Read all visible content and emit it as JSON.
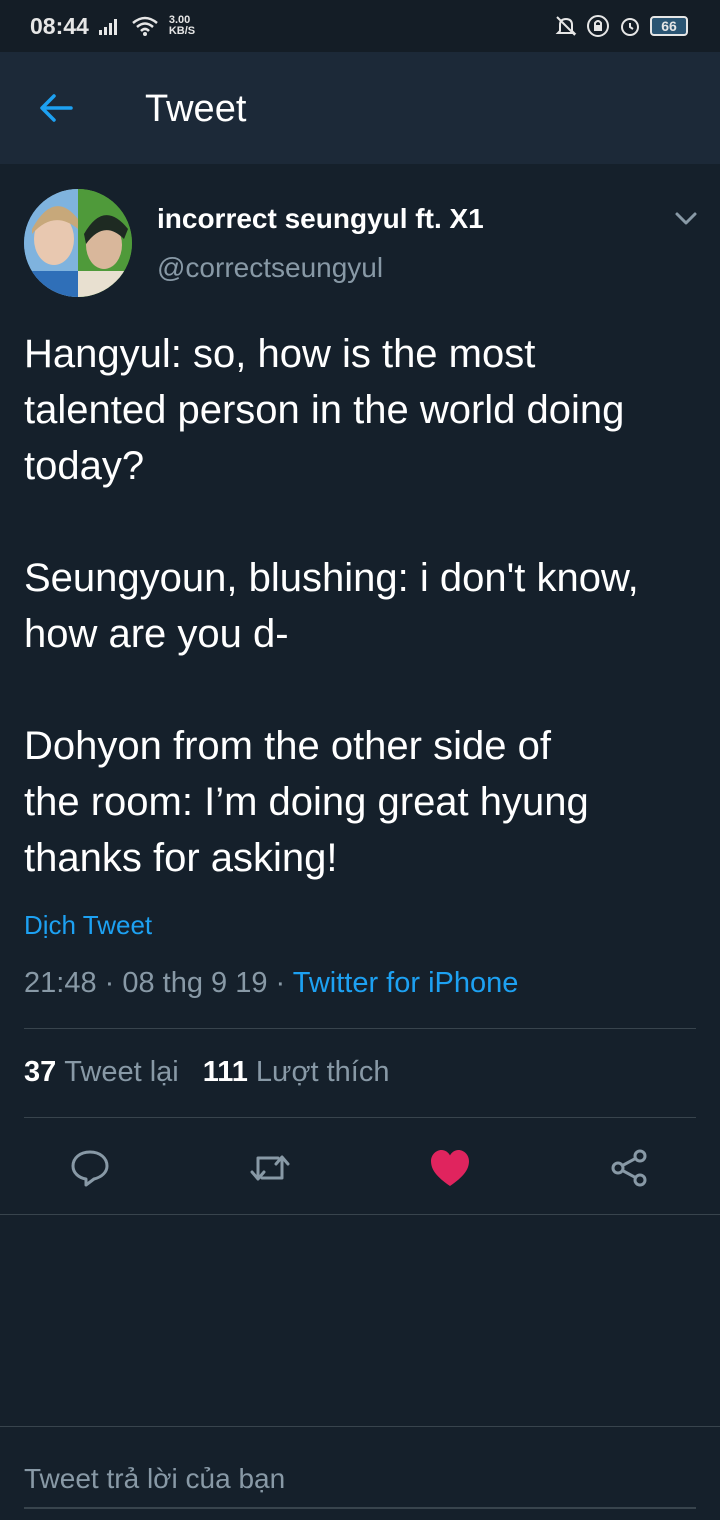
{
  "status_bar": {
    "time": "08:44",
    "speed_value": "3.00",
    "speed_unit": "KB/S",
    "battery": "66"
  },
  "header": {
    "title": "Tweet"
  },
  "tweet": {
    "author_name": "incorrect seungyul ft. X1",
    "author_handle": "@correctseungyul",
    "paragraphs": [
      [
        "Hangyul: so, how is the most",
        "talented person in the world doing",
        "today?"
      ],
      [
        "Seungyoun, blushing: i don't know,",
        "how are you d-"
      ],
      [
        "Dohyon from the other side of",
        "the room: I’m doing great hyung",
        "thanks for asking!"
      ]
    ],
    "translate_label": "Dịch Tweet",
    "timestamp": "21:48 · 08 thg 9 19 · ",
    "source": "Twitter for iPhone"
  },
  "stats": {
    "retweets_count": "37",
    "retweets_label": "Tweet lại",
    "likes_count": "111",
    "likes_label": "Lượt thích"
  },
  "reply": {
    "placeholder": "Tweet trả lời của bạn"
  },
  "colors": {
    "background": "#15202b",
    "header": "#1c2938",
    "accent": "#1da1f2",
    "muted": "#8899a6",
    "like": "#e0245e"
  }
}
